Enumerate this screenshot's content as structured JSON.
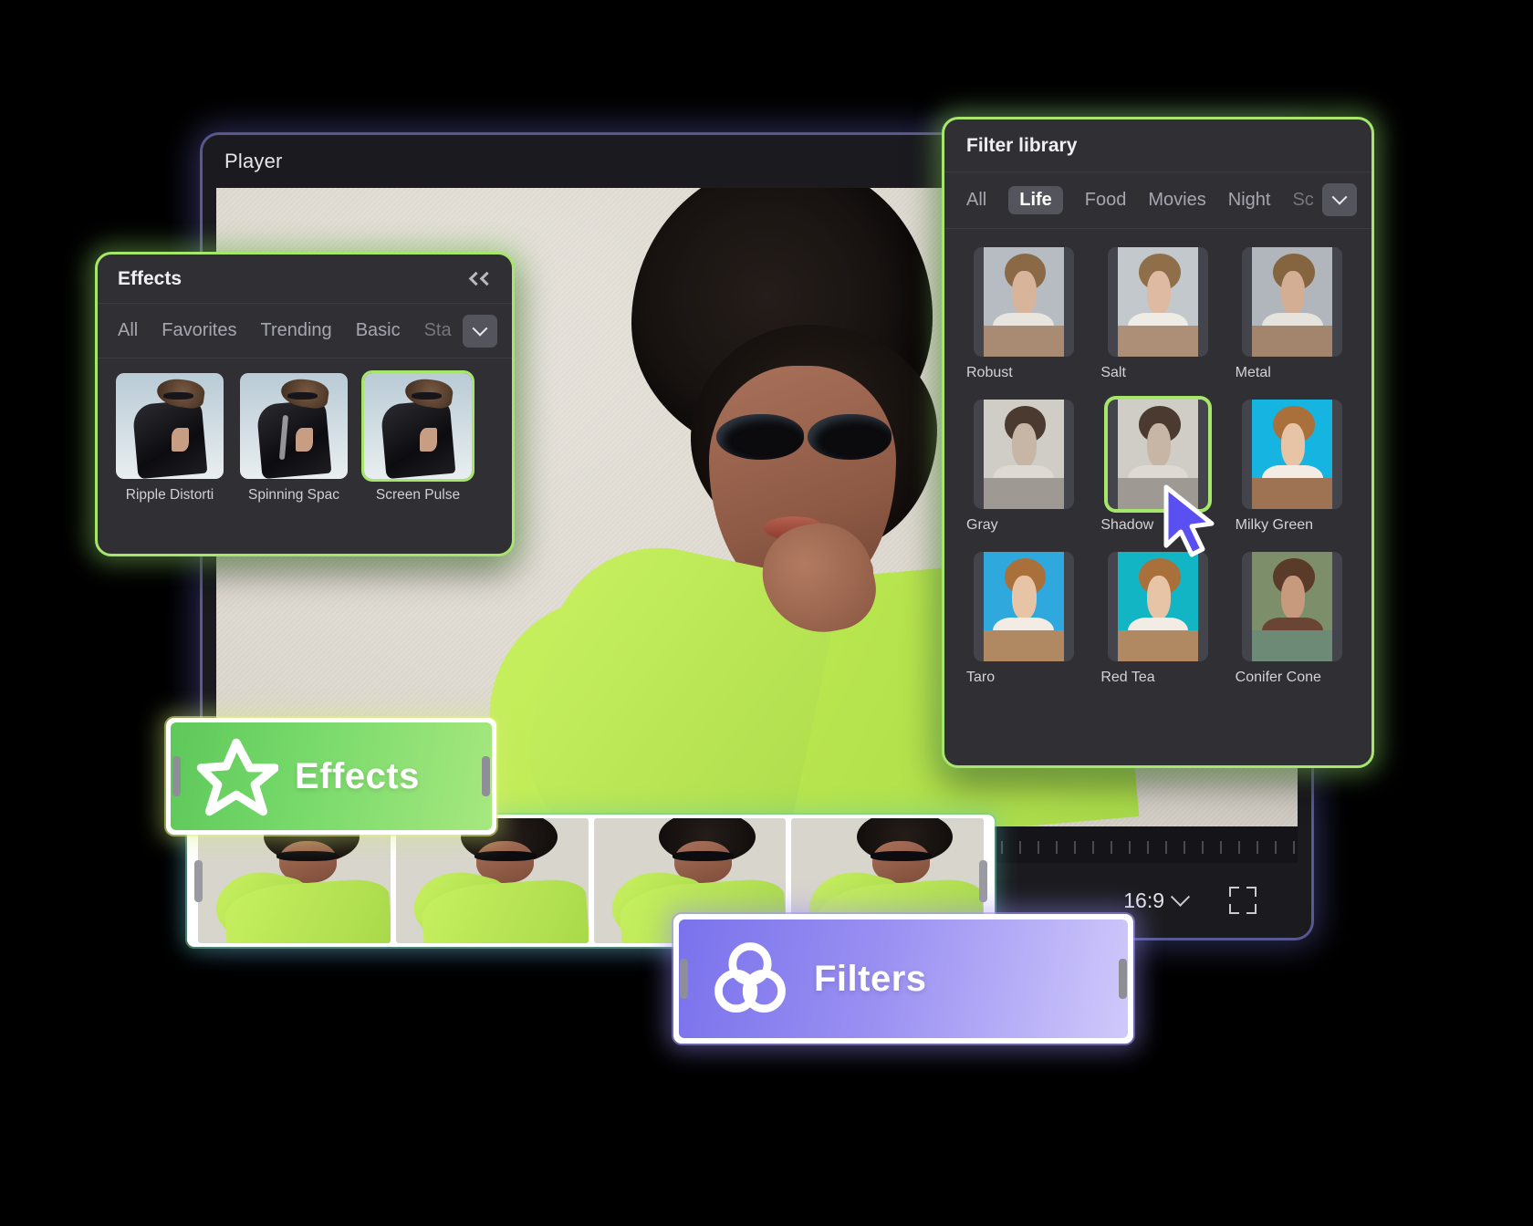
{
  "player": {
    "title": "Player",
    "aspect_ratio": "16:9",
    "aspect_chevron_icon": "chevron-down-icon",
    "fullscreen_icon": "fullscreen-icon"
  },
  "effects_panel": {
    "title": "Effects",
    "collapse_icon": "double-chevron-left-icon",
    "more_icon": "chevron-down-icon",
    "tabs": [
      {
        "label": "All",
        "active": false
      },
      {
        "label": "Favorites",
        "active": false
      },
      {
        "label": "Trending",
        "active": false
      },
      {
        "label": "Basic",
        "active": false
      },
      {
        "label": "Sta",
        "active": false,
        "truncated": true
      }
    ],
    "items": [
      {
        "label": "Ripple Distorti",
        "selected": false
      },
      {
        "label": "Spinning Spac",
        "selected": false
      },
      {
        "label": "Screen Pulse",
        "selected": true
      }
    ]
  },
  "filter_panel": {
    "title": "Filter library",
    "more_icon": "chevron-down-icon",
    "tabs": [
      {
        "label": "All",
        "active": false
      },
      {
        "label": "Life",
        "active": true
      },
      {
        "label": "Food",
        "active": false
      },
      {
        "label": "Movies",
        "active": false
      },
      {
        "label": "Night",
        "active": false
      },
      {
        "label": "Sc",
        "active": false,
        "truncated": true
      }
    ],
    "items": [
      {
        "label": "Robust",
        "selected": false,
        "top": "#b6bcc2",
        "hair": "#8a6a46",
        "face": "#d8b49a",
        "torso": "#b99a7c",
        "bottom": "#a98a73"
      },
      {
        "label": "Salt",
        "selected": false,
        "top": "#c3c8cc",
        "hair": "#8f6f4a",
        "face": "#ddbaa1",
        "torso": "#bd9e80",
        "bottom": "#ad8e77"
      },
      {
        "label": "Metal",
        "selected": false,
        "top": "#b0b6bc",
        "hair": "#85653f",
        "face": "#d3ae94",
        "torso": "#b39476",
        "bottom": "#a3846d"
      },
      {
        "label": "Gray",
        "selected": false,
        "top": "#cfcdc6",
        "hair": "#4a3a30",
        "face": "#c7b6a6",
        "torso": "#dedad2",
        "bottom": "#9e9a93"
      },
      {
        "label": "Shadow",
        "selected": true,
        "top": "#cfcdc6",
        "hair": "#4a3a30",
        "face": "#c7b6a6",
        "torso": "#dedad2",
        "bottom": "#9e9a93"
      },
      {
        "label": "Milky Green",
        "selected": false,
        "top": "#16b4e0",
        "hair": "#a9703c",
        "face": "#e8c4a6",
        "torso": "#f2ece4",
        "bottom": "#9d7354"
      },
      {
        "label": "Taro",
        "selected": false,
        "top": "#2fa8dd",
        "hair": "#a9703c",
        "face": "#e8c4a6",
        "torso": "#f2ece4",
        "bottom": "#b08963"
      },
      {
        "label": "Red Tea",
        "selected": false,
        "top": "#12b5c4",
        "hair": "#a9703c",
        "face": "#e8c4a6",
        "torso": "#f2ece4",
        "bottom": "#b08963"
      },
      {
        "label": "Conifer Cone",
        "selected": false,
        "top": "#7c8f6a",
        "hair": "#5a3a28",
        "face": "#c79a7e",
        "torso": "#6a4434",
        "bottom": "#6d8a77"
      }
    ]
  },
  "clips": {
    "effects": {
      "label": "Effects",
      "icon": "star-outline-icon",
      "color": "#6ed061"
    },
    "filters": {
      "label": "Filters",
      "icon": "three-circles-icon",
      "color": "#8a80ef"
    }
  },
  "timeline": {
    "playhead_color": "#18b8c4",
    "frame_count": 4
  },
  "cursor": {
    "icon": "arrow-pointer-icon",
    "color": "#5a4ff0"
  }
}
